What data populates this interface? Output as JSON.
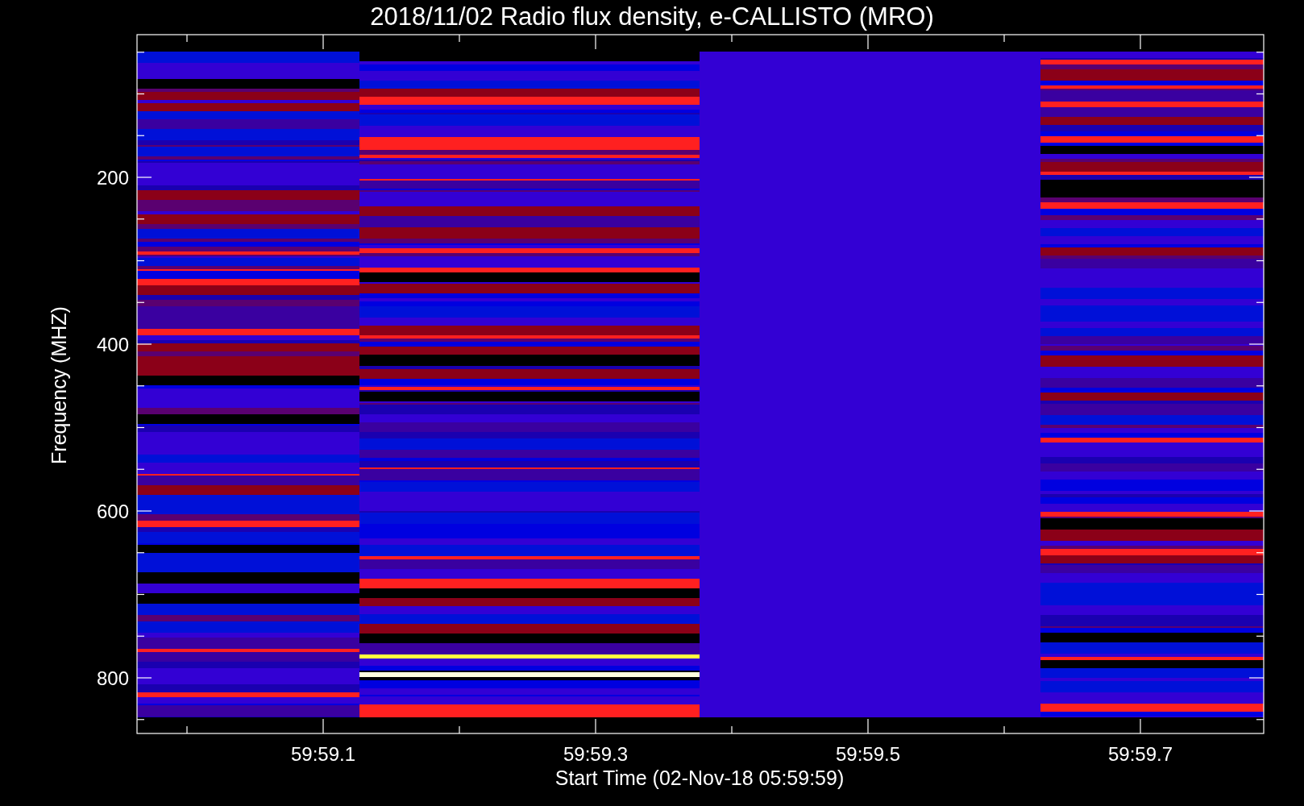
{
  "title": "2018/11/02  Radio flux density, e-CALLISTO (MRO)",
  "y_axis": {
    "label": "Frequency (MHZ)",
    "ticks": [
      "200",
      "400",
      "600",
      "800"
    ]
  },
  "x_axis": {
    "label": "Start Time (02-Nov-18 05:59:59)",
    "ticks": [
      "59:59.1",
      "59:59.3",
      "59:59.5",
      "59:59.7"
    ]
  }
}
